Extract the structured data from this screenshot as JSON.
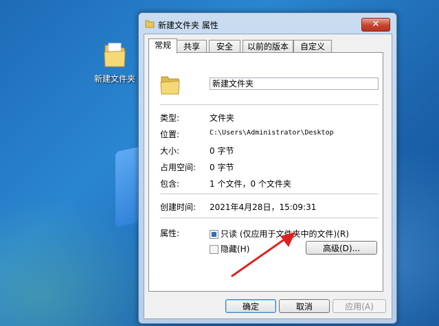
{
  "desktop": {
    "icon_label": "新建文件夹"
  },
  "dialog": {
    "title": "新建文件夹 属性",
    "close_glyph": "✕",
    "tabs": [
      "常规",
      "共享",
      "安全",
      "以前的版本",
      "自定义"
    ],
    "folder_name": "新建文件夹",
    "props": {
      "type_label": "类型:",
      "type_value": "文件夹",
      "location_label": "位置:",
      "location_value": "C:\\Users\\Administrator\\Desktop",
      "size_label": "大小:",
      "size_value": "0 字节",
      "disk_label": "占用空间:",
      "disk_value": "0 字节",
      "contains_label": "包含:",
      "contains_value": "1 个文件，0 个文件夹",
      "created_label": "创建时间:",
      "created_value": "2021年4月28日，15:09:31",
      "attr_label": "属性:"
    },
    "attributes": {
      "readonly_label": "只读 (仅应用于文件夹中的文件)(R)",
      "readonly_checked": true,
      "hidden_label": "隐藏(H)",
      "hidden_checked": false,
      "advanced_label": "高级(D)..."
    },
    "buttons": {
      "ok": "确定",
      "cancel": "取消",
      "apply": "应用(A)"
    }
  },
  "colors": {
    "accent_arrow": "#e02020",
    "close_button": "#c8432d",
    "checkbox_fill": "#2f6fb8"
  }
}
